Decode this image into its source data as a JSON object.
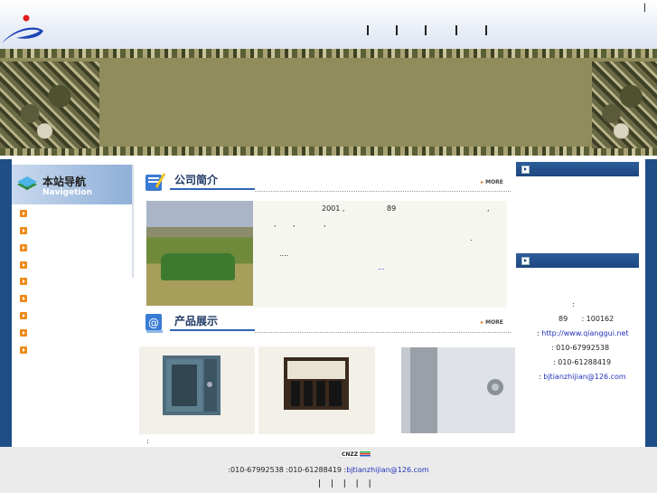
{
  "header": {
    "top_separator": "|",
    "nav_separators": [
      "|",
      "|",
      "|",
      "|",
      "|"
    ]
  },
  "sidebar": {
    "title": "本站导航",
    "subtitle": "Navigetion",
    "items": [
      "",
      "",
      "",
      "",
      "",
      "",
      "",
      "",
      ""
    ]
  },
  "about": {
    "title": "公司简介",
    "more_label": "MORE",
    "lines": [
      {
        "a": "2001 ,",
        "b": "89",
        "c": ","
      },
      {
        "a": ",",
        "b": ",",
        "c": ","
      },
      {
        "a": "."
      },
      {
        "a": "...."
      },
      {
        "a": "..."
      }
    ]
  },
  "products": {
    "title": "产品展示",
    "more_label": "MORE",
    "captions": [
      "",
      ""
    ],
    "note": ":"
  },
  "contact": {
    "colon": ":",
    "post": "89      : 100162",
    "web_label": ":",
    "web_url": "http://www.qianggui.net",
    "tel1": ": 010-67992538",
    "tel2": ": 010-61288419",
    "email_label": ":",
    "email": "bjtianzhijian@126.com"
  },
  "footer": {
    "badge": "CNZZ",
    "tel_line": ":010-67992538   :010-61288419   :",
    "email": "bjtianzhijian@126.com",
    "separators": "| | | | |"
  },
  "colors": {
    "frame": "#1f4e86",
    "accent": "#2f66b3",
    "bullet": "#ee8a1a",
    "camo": "#8d8a5a"
  }
}
